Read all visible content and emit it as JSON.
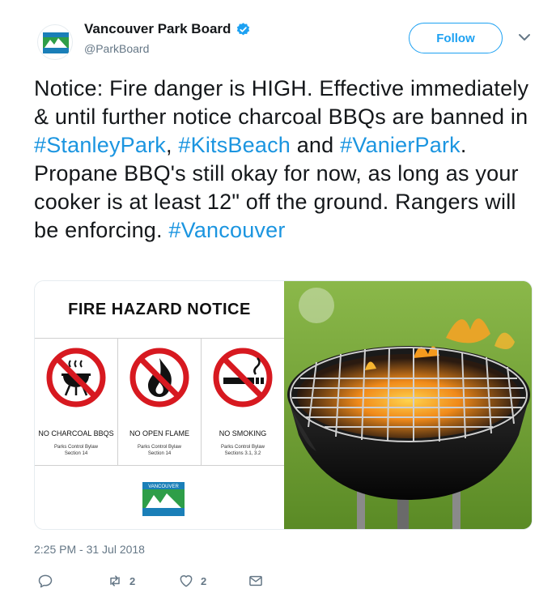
{
  "account": {
    "display_name": "Vancouver Park Board",
    "handle": "@ParkBoard",
    "avatar_text": "VANCOUVER"
  },
  "follow_label": "Follow",
  "tweet": {
    "segments": [
      {
        "text": "Notice: Fire danger is HIGH.  Effective immediately & until further notice charcoal BBQs are banned in ",
        "hashtag": false
      },
      {
        "text": "#StanleyPark",
        "hashtag": true
      },
      {
        "text": ", ",
        "hashtag": false
      },
      {
        "text": "#KitsBeach",
        "hashtag": true
      },
      {
        "text": " and ",
        "hashtag": false
      },
      {
        "text": "#VanierPark",
        "hashtag": true
      },
      {
        "text": ". Propane BBQ's still okay for now, as long as your cooker is at least 12\" off the ground. Rangers will be enforcing. ",
        "hashtag": false
      },
      {
        "text": "#Vancouver",
        "hashtag": true
      }
    ]
  },
  "notice": {
    "title": "FIRE HAZARD NOTICE",
    "items": [
      {
        "label": "NO CHARCOAL BBQS",
        "bylaw": "Parks Control Bylaw\nSection 14",
        "icon": "no-charcoal-bbq-icon"
      },
      {
        "label": "NO OPEN FLAME",
        "bylaw": "Parks Control Bylaw\nSection 14",
        "icon": "no-open-flame-icon"
      },
      {
        "label": "NO SMOKING",
        "bylaw": "Parks Control Bylaw\nSections 3.1, 3.2",
        "icon": "no-smoking-icon"
      }
    ],
    "logo_text": "VANCOUVER"
  },
  "timestamp": "2:25 PM - 31 Jul 2018",
  "actions": {
    "reply_icon": "reply-icon",
    "retweet_count": "2",
    "like_count": "2",
    "dm_icon": "envelope-icon"
  },
  "colors": {
    "accent": "#1da1f2",
    "hashtag": "#1b95e0",
    "muted": "#657786",
    "prohibition_red": "#d71920"
  }
}
